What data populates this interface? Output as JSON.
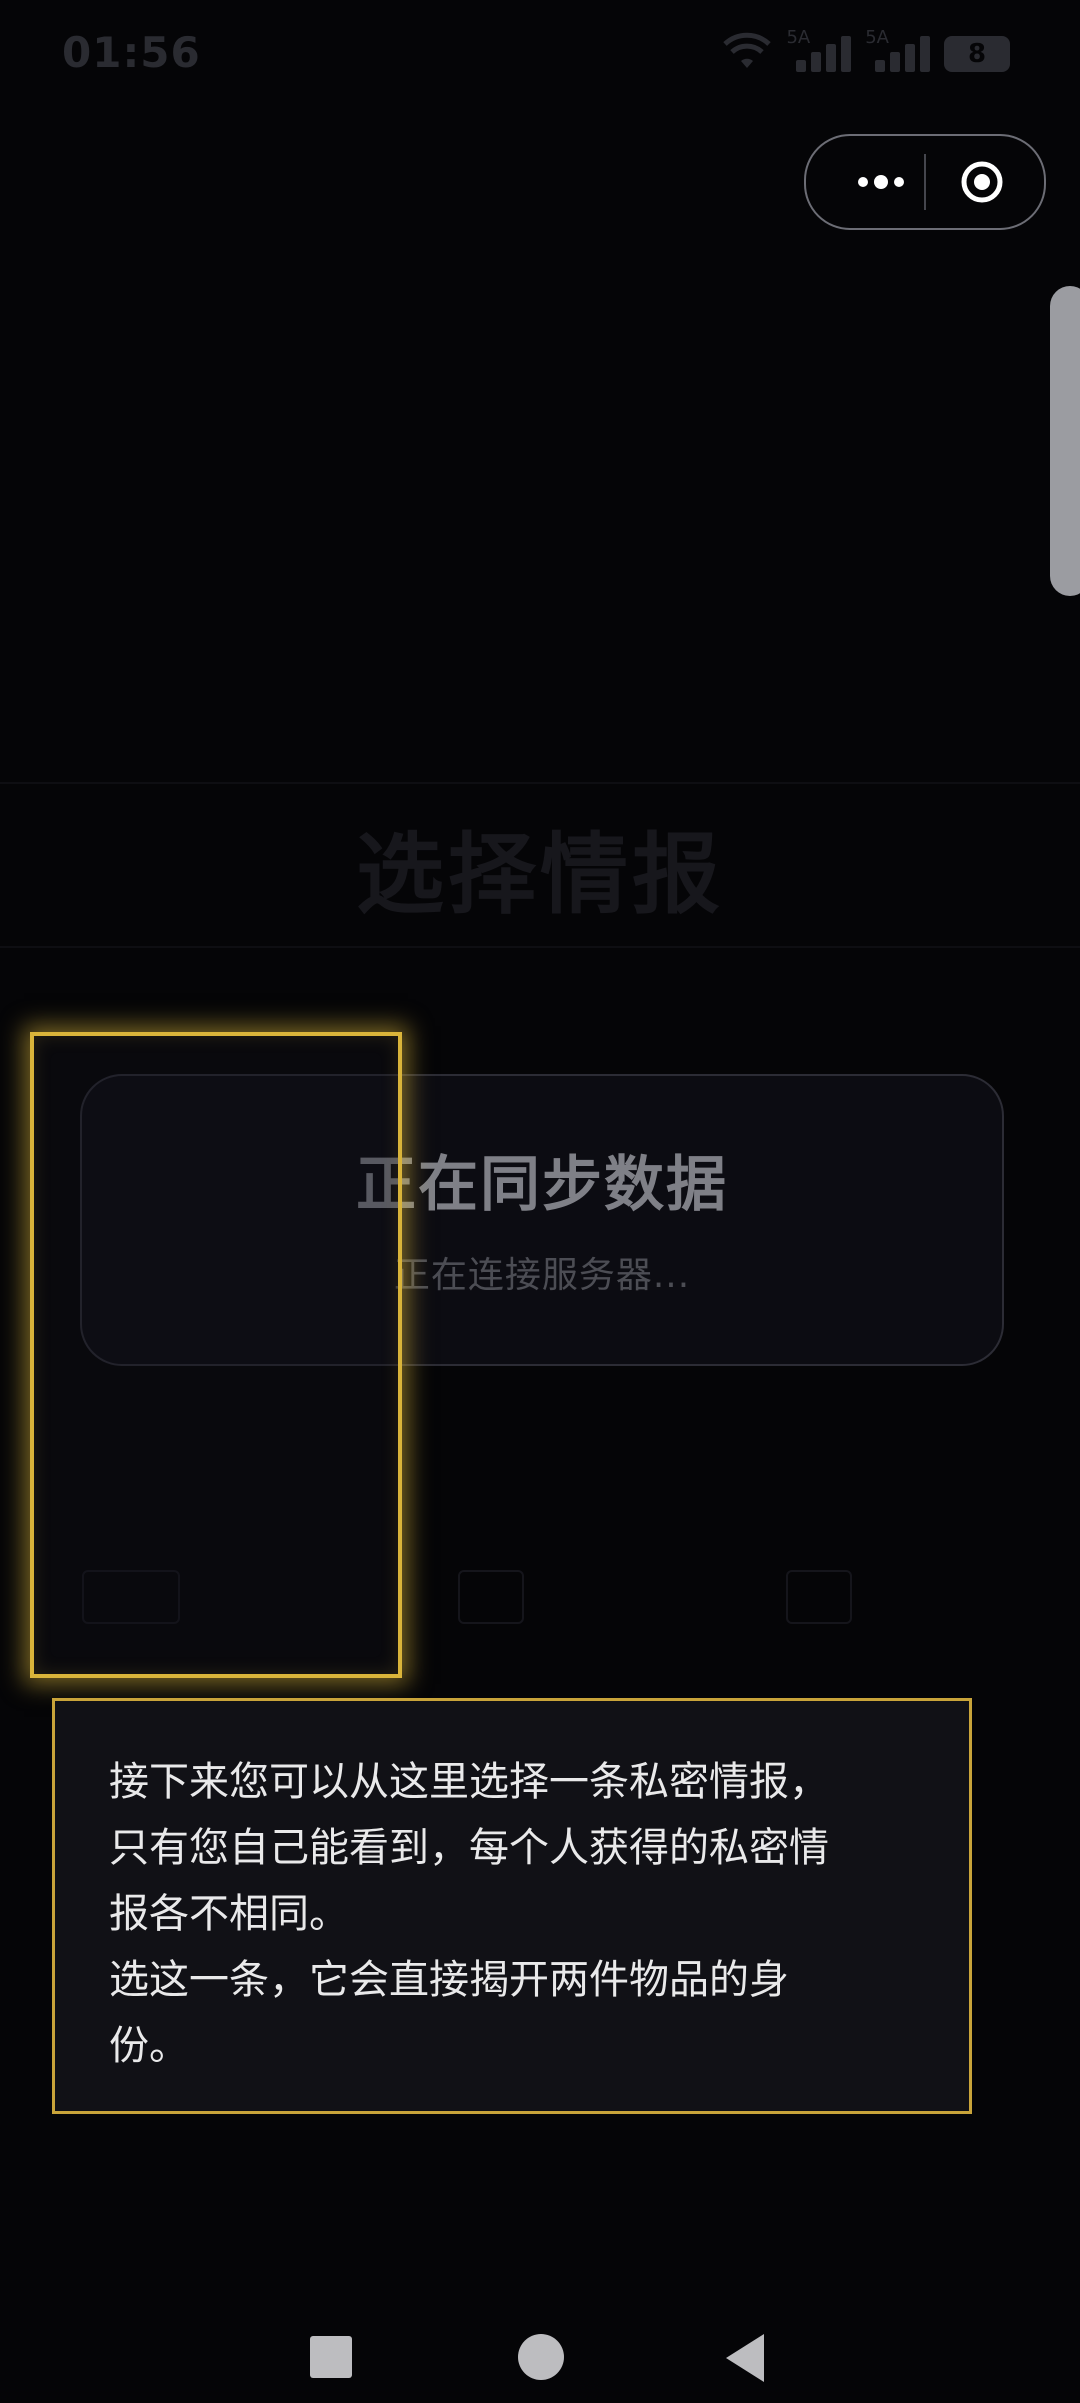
{
  "status_bar": {
    "time": "01:56",
    "network_label_1": "5A",
    "network_label_2": "5A",
    "battery": "8"
  },
  "capsule": {
    "more_icon": "more-dots-icon",
    "close_icon": "target-close-icon"
  },
  "background": {
    "title": "选择情报"
  },
  "sync_card": {
    "title": "正在同步数据",
    "subtitle": "正在连接服务器..."
  },
  "tooltip": {
    "lines": [
      "接下来您可以从这里选择一条私密情报，",
      "只有您自己能看到，每个人获得的私密情",
      "报各不相同。",
      "选这一条，它会直接揭开两件物品的身",
      "份。"
    ]
  },
  "colors": {
    "accent_gold": "#d9b43a",
    "background": "#050507"
  },
  "nav": {
    "recent_icon": "square-recents-icon",
    "home_icon": "circle-home-icon",
    "back_icon": "triangle-back-icon"
  }
}
